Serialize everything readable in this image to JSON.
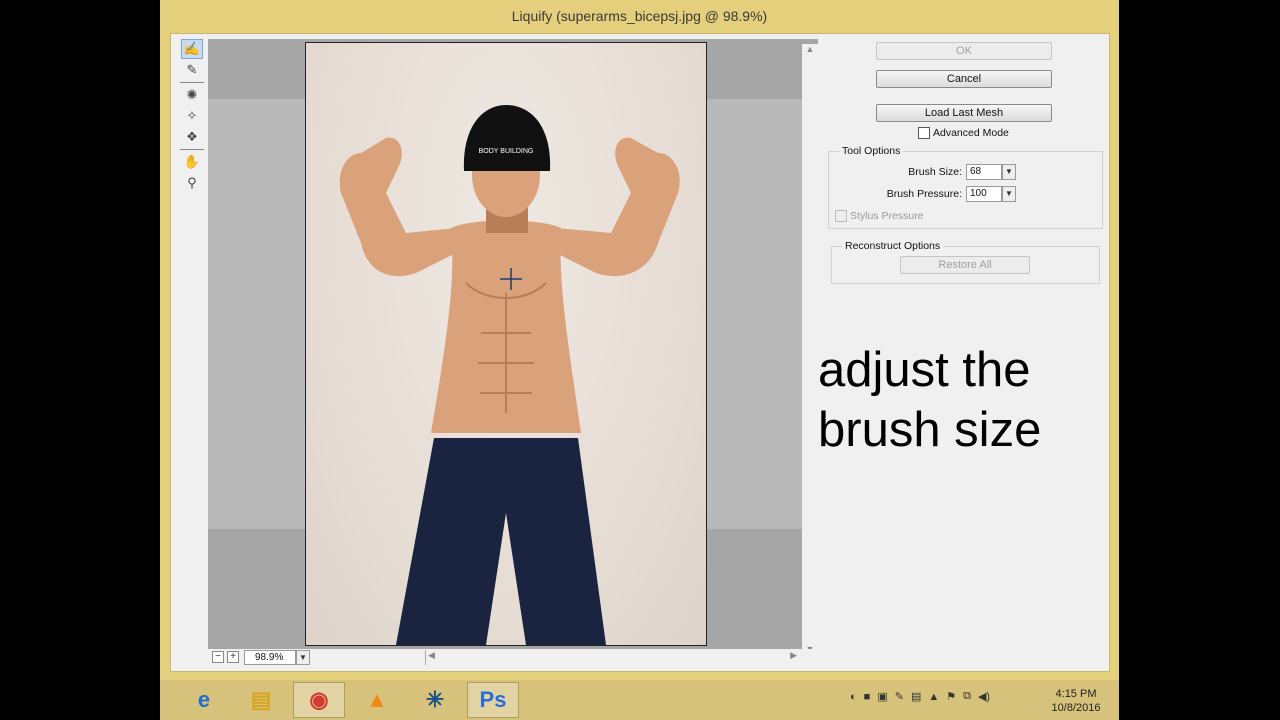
{
  "window": {
    "title": "Liquify (superarms_bicepsj.jpg @ 98.9%)"
  },
  "tools": [
    {
      "name": "forward-warp-tool-icon",
      "glyph": "✍"
    },
    {
      "name": "reconstruct-tool-icon",
      "glyph": "✎"
    },
    {
      "name": "twirl-tool-icon",
      "glyph": "✺"
    },
    {
      "name": "pucker-tool-icon",
      "glyph": "✧"
    },
    {
      "name": "bloat-tool-icon",
      "glyph": "❖"
    },
    {
      "name": "hand-tool-icon",
      "glyph": "✋"
    },
    {
      "name": "zoom-tool-icon",
      "glyph": "⚲"
    }
  ],
  "buttons": {
    "ok": "OK",
    "cancel": "Cancel",
    "load_last_mesh": "Load Last Mesh",
    "restore_all": "Restore All"
  },
  "advanced_mode": {
    "label": "Advanced Mode",
    "checked": false
  },
  "tool_options": {
    "title": "Tool Options",
    "brush_size_label": "Brush Size:",
    "brush_size": "68",
    "brush_pressure_label": "Brush Pressure:",
    "brush_pressure": "100",
    "stylus_pressure_label": "Stylus Pressure"
  },
  "reconstruct_options": {
    "title": "Reconstruct Options"
  },
  "zoom": {
    "value": "98.9%",
    "minus": "−",
    "plus": "+"
  },
  "photo": {
    "beanie_text": "BODY BUILDING",
    "skin": "#d9a27a",
    "skin_dark": "#b97e58",
    "shorts": "#1a2340",
    "beanie": "#111111"
  },
  "overlay": {
    "line1": "adjust the",
    "line2": "brush size"
  },
  "taskbar": {
    "apps": [
      {
        "name": "internet-explorer-icon",
        "glyph": "e",
        "color": "#1e6fd0"
      },
      {
        "name": "file-explorer-icon",
        "glyph": "▤",
        "color": "#d9a520"
      },
      {
        "name": "chrome-icon",
        "glyph": "◉",
        "color": "#d23b2f"
      },
      {
        "name": "vlc-icon",
        "glyph": "▲",
        "color": "#f08a14"
      },
      {
        "name": "snowflake-app-icon",
        "glyph": "✳",
        "color": "#1b4f8a"
      },
      {
        "name": "photoshop-icon",
        "glyph": "Ps",
        "color": "#2a6dd8"
      }
    ],
    "time": "4:15 PM",
    "date": "10/8/2016"
  }
}
